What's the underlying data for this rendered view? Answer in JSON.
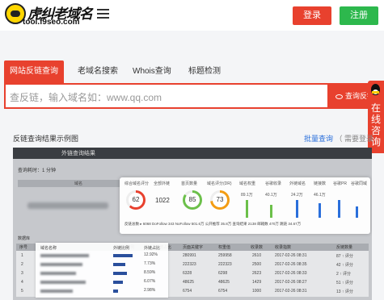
{
  "header": {
    "logo_title": "虎纠老域名",
    "logo_url": "tool.f9seo.com",
    "login_label": "登录",
    "register_label": "注册",
    "colors": {
      "accent": "#e8412e",
      "register": "#2db84d"
    }
  },
  "tabs": [
    {
      "label": "网站反链查询",
      "active": true
    },
    {
      "label": "老域名搜索",
      "active": false
    },
    {
      "label": "Whois查询",
      "active": false
    },
    {
      "label": "标题检测",
      "active": false
    }
  ],
  "search": {
    "placeholder": "查反链，输入域名如：www.qq.com",
    "button_label": "查询反链"
  },
  "side_float": {
    "text": "在线咨询",
    "icon": "qq-penguin-icon"
  },
  "example": {
    "title": "反链查询结果示例图",
    "link_batch": "批量查询",
    "link_note": "（ 需要登录"
  },
  "screenshot": {
    "topbar_title": "外链查询结果",
    "panel_label": "查询耗时：1 分钟",
    "domain_col": "域名",
    "card_headers": [
      "综合域名评分",
      "全部外链",
      "首页数量",
      "域名评分(DR)",
      "域名权重",
      "谷歌收录",
      "外链域名",
      "链接数",
      "谷歌PR",
      "谷歌同域"
    ],
    "scores": [
      "62",
      "1022",
      "85",
      "73"
    ],
    "card_small_values": [
      "89.1万",
      "40.1万",
      "24.2万",
      "46.1万"
    ],
    "stats_line": "反链总数 ▸ 6068   DoFollow 343   NoFollow 501.6万   公开推荐 35.8万   查询结果 2138   邮箱数 470万   跳链 34.67万",
    "sub_label": "数据库",
    "table_headers": [
      "序号",
      "域名名称",
      "外链比例",
      "外链占比",
      "页面关键字",
      "权重值",
      "收录数",
      "收录指数",
      "添加时间",
      "反链数量"
    ],
    "table_rows": [
      {
        "no": "1",
        "pct": "12.92%",
        "kw": "280991",
        "w": "259958",
        "n": "2610",
        "date": "2017-02-26 08:31",
        "links": "87 ↑ 评分"
      },
      {
        "no": "2",
        "pct": "7.73%",
        "kw": "222323",
        "w": "222323",
        "n": "2500",
        "date": "2017-02-26 08:35",
        "links": "42 ↑ 评分"
      },
      {
        "no": "3",
        "pct": "8.59%",
        "kw": "6328",
        "w": "6298",
        "n": "2623",
        "date": "2017-02-26 08:33",
        "links": "2 ↑ 评分"
      },
      {
        "no": "4",
        "pct": "6.07%",
        "kw": "48625",
        "w": "48625",
        "n": "1429",
        "date": "2017-02-26 08:27",
        "links": "51 ↑ 评分"
      },
      {
        "no": "5",
        "pct": "2.98%",
        "kw": "6754",
        "w": "6754",
        "n": "1000",
        "date": "2017-02-26 08:31",
        "links": "13 ↑ 评分"
      }
    ]
  }
}
